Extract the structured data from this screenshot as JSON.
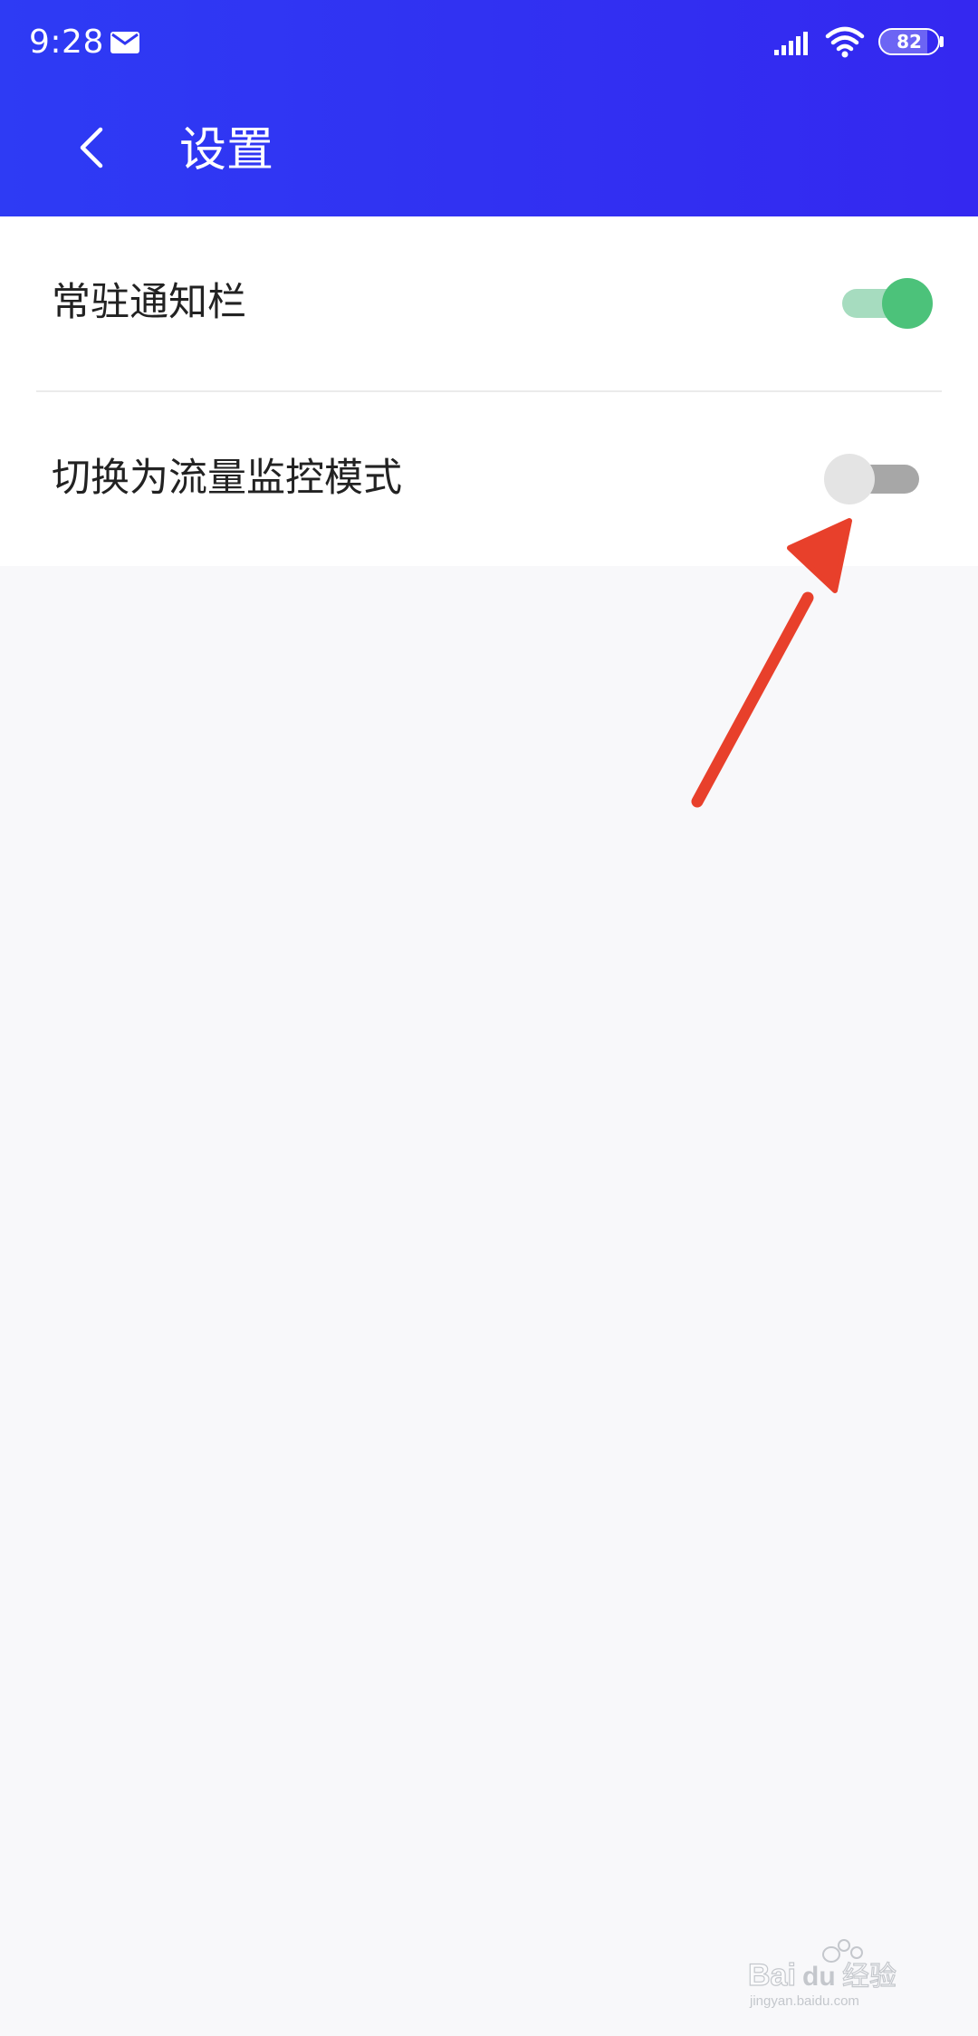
{
  "status_bar": {
    "time": "9:28",
    "battery_level": "82",
    "battery_fraction": 0.82,
    "icons": [
      "mail-icon",
      "signal-icon",
      "wifi-icon",
      "battery-icon"
    ]
  },
  "toolbar": {
    "back_icon": "chevron-left-icon",
    "title": "设置"
  },
  "settings": {
    "items": [
      {
        "label": "常驻通知栏",
        "enabled": true
      },
      {
        "label": "切换为流量监控模式",
        "enabled": false
      }
    ]
  },
  "annotation": {
    "type": "arrow",
    "color": "#e8402b",
    "target": "切换为流量监控模式 toggle"
  },
  "watermark": {
    "brand": "Baidu经验",
    "url": "jingyan.baidu.com"
  },
  "colors": {
    "header_gradient_start": "#2e3bf4",
    "header_gradient_end": "#3428f0",
    "toggle_on": "#4cc27a",
    "toggle_on_track": "#a6dcbf",
    "toggle_off_thumb": "#e4e4e4",
    "toggle_off_track": "#a7a7a7",
    "background": "#f8f8fa"
  }
}
